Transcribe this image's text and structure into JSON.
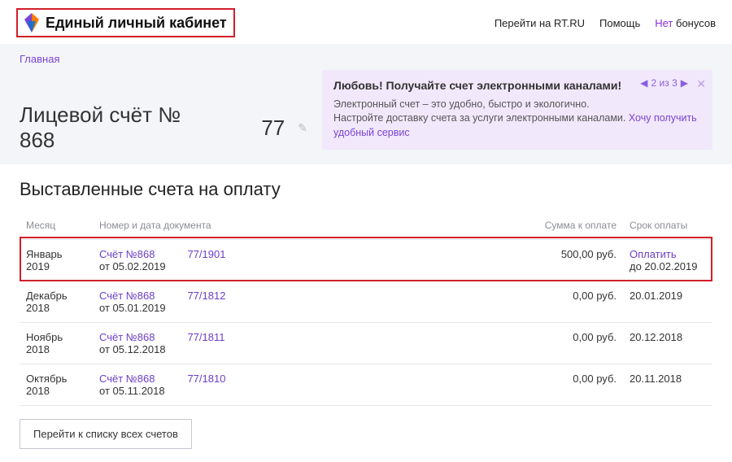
{
  "header": {
    "brand_title": "Единый личный кабинет",
    "links": {
      "goto_rt": "Перейти на RT.RU",
      "help": "Помощь",
      "bonus_prefix": "Нет",
      "bonus_word": "бонусов"
    }
  },
  "breadcrumb": "Главная",
  "account": {
    "label": "Лицевой счёт № 868",
    "suffix": "77"
  },
  "notice": {
    "title": "Любовь! Получайте счет электронными каналами!",
    "line1": "Электронный счет – это удобно, быстро и экологично.",
    "line2": "Настройте доставку счета за услуги электронными каналами.",
    "link": "Хочу получить удобный сервис",
    "pager": "2 из 3"
  },
  "section_title": "Выставленные счета на оплату",
  "columns": {
    "month": "Месяц",
    "doc": "Номер и дата документа",
    "amount": "Сумма к оплате",
    "due": "Срок оплаты"
  },
  "rows": [
    {
      "month_line1": "Январь",
      "month_line2": "2019",
      "doc_no": "Счёт №868",
      "doc_code": "77/1901",
      "doc_date": "от 05.02.2019",
      "amount": "500,00 руб.",
      "pay_label": "Оплатить",
      "due": "до 20.02.2019",
      "highlight": true
    },
    {
      "month_line1": "Декабрь",
      "month_line2": "2018",
      "doc_no": "Счёт №868",
      "doc_code": "77/1812",
      "doc_date": "от 05.01.2019",
      "amount": "0,00 руб.",
      "pay_label": "",
      "due": "20.01.2019",
      "highlight": false
    },
    {
      "month_line1": "Ноябрь",
      "month_line2": "2018",
      "doc_no": "Счёт №868",
      "doc_code": "77/1811",
      "doc_date": "от 05.12.2018",
      "amount": "0,00 руб.",
      "pay_label": "",
      "due": "20.12.2018",
      "highlight": false
    },
    {
      "month_line1": "Октябрь",
      "month_line2": "2018",
      "doc_no": "Счёт №868",
      "doc_code": "77/1810",
      "doc_date": "от 05.11.2018",
      "amount": "0,00 руб.",
      "pay_label": "",
      "due": "20.11.2018",
      "highlight": false
    }
  ],
  "all_bills_button": "Перейти к списку всех счетов"
}
